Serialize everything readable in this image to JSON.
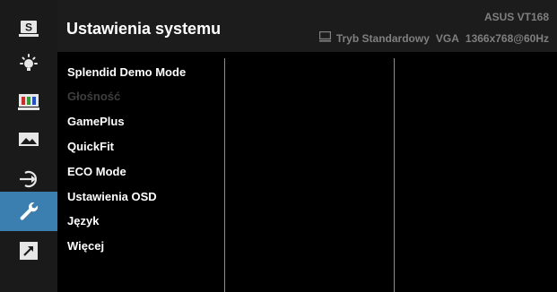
{
  "header": {
    "title": "Ustawienia systemu",
    "model": "ASUS VT168",
    "status": {
      "mode": "Tryb Standardowy",
      "input": "VGA",
      "resolution": "1366x768@60Hz"
    }
  },
  "sidebar": {
    "icons": [
      {
        "name": "splendid-icon",
        "glyph": "S"
      },
      {
        "name": "brightness-icon"
      },
      {
        "name": "color-icon"
      },
      {
        "name": "image-icon"
      },
      {
        "name": "input-select-icon"
      },
      {
        "name": "system-setup-icon",
        "active": true
      },
      {
        "name": "shortcut-icon"
      }
    ]
  },
  "menu": {
    "items": [
      {
        "label": "Splendid Demo Mode",
        "enabled": true
      },
      {
        "label": "Głośność",
        "enabled": false
      },
      {
        "label": "GamePlus",
        "enabled": true
      },
      {
        "label": "QuickFit",
        "enabled": true
      },
      {
        "label": "ECO Mode",
        "enabled": true
      },
      {
        "label": "Ustawienia OSD",
        "enabled": true
      },
      {
        "label": "Język",
        "enabled": true
      },
      {
        "label": "Więcej",
        "enabled": true
      }
    ]
  },
  "colors": {
    "background": "#000000",
    "header_bg": "#1c1c1c",
    "active_accent": "#3a7fb0",
    "text_primary": "#ffffff",
    "text_secondary": "#7f7f7f",
    "text_disabled": "#3e3e3e"
  }
}
